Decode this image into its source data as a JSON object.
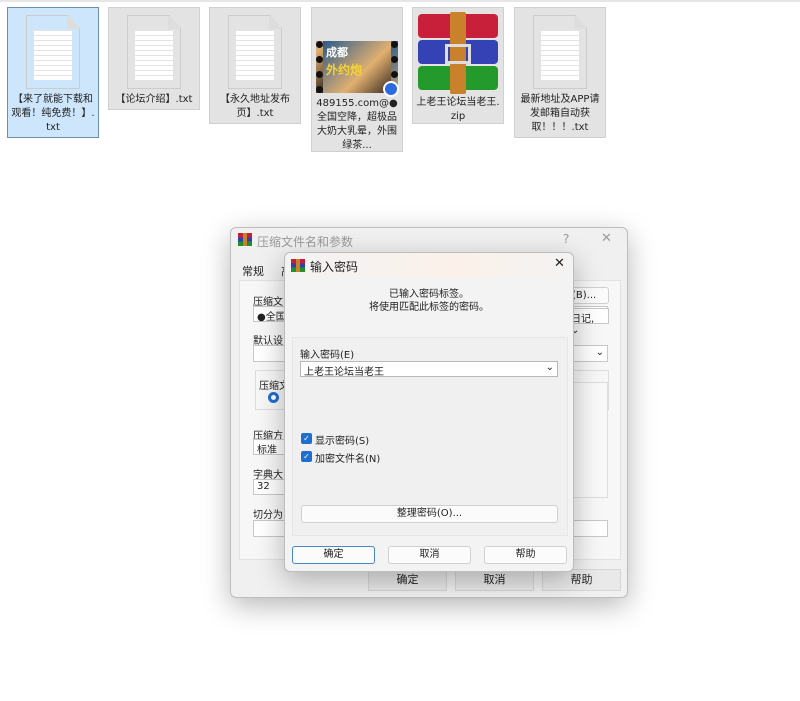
{
  "desktop": {
    "files": [
      {
        "name": "【来了就能下载和观看！纯免费！】.txt",
        "icon": "text-file-icon",
        "selected": true
      },
      {
        "name": "【论坛介绍】.txt",
        "icon": "text-file-icon"
      },
      {
        "name": "【永久地址发布页】.txt",
        "icon": "text-file-icon"
      },
      {
        "name": "489155.com@●全国空降，超极品大奶大乳晕，外围绿茶...",
        "icon": "video-thumbnail-icon",
        "thumb_text_1": "成都",
        "thumb_text_2": "外约炮"
      },
      {
        "name": "上老王论坛当老王.zip",
        "icon": "winrar-archive-icon"
      },
      {
        "name": "最新地址及APP请发邮箱自动获取！！！.txt",
        "icon": "text-file-icon"
      }
    ]
  },
  "background_dialog": {
    "title": "压缩文件名和参数",
    "help": "?",
    "close": "✕",
    "tabs": [
      "常规",
      "高"
    ],
    "archive_name_label": "压缩文",
    "archive_name_value": "●全国",
    "browse_button": "(B)...",
    "update_mode_value": "日记,",
    "default_profile_label": "默认设",
    "format_label": "压缩文",
    "compression_label": "压缩方",
    "compression_value": "标准",
    "dictionary_label": "字典大",
    "dictionary_value": "32",
    "split_label": "切分为",
    "ok": "确定",
    "cancel": "取消",
    "help_button": "帮助"
  },
  "password_dialog": {
    "title": "输入密码",
    "close": "✕",
    "message_line1": "已输入密码标签。",
    "message_line2": "将使用匹配此标签的密码。",
    "password_label": "输入密码(E)",
    "password_value": "上老王论坛当老王",
    "show_password": {
      "label": "显示密码(S)",
      "checked": true
    },
    "encrypt_filenames": {
      "label": "加密文件名(N)",
      "checked": true
    },
    "organize_button": "整理密码(O)...",
    "ok": "确定",
    "cancel": "取消",
    "help": "帮助"
  },
  "colors": {
    "accent": "#1f6fd0",
    "selection": "#cde6fb"
  }
}
